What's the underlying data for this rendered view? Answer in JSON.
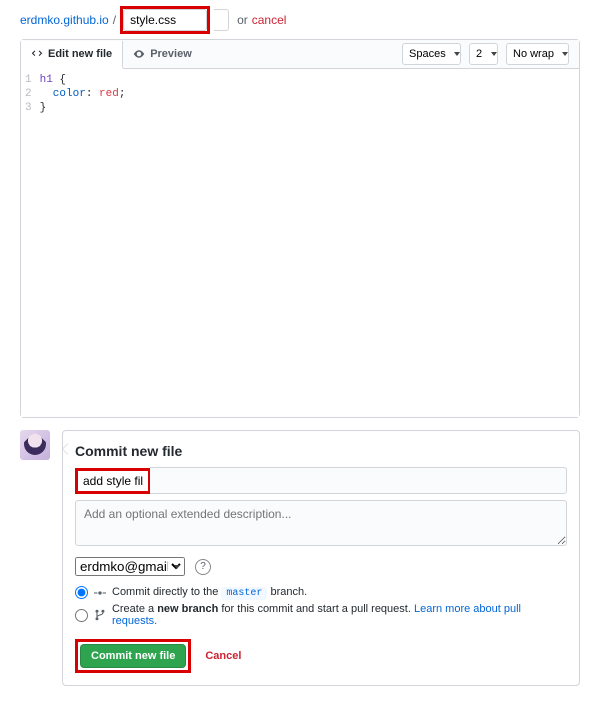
{
  "breadcrumb": {
    "repo": "erdmko.github.io",
    "filename": "style.css",
    "or": "or",
    "cancel": "cancel"
  },
  "tabs": {
    "edit": "Edit new file",
    "preview": "Preview"
  },
  "indent_mode": "Spaces",
  "indent_size": "2",
  "wrap_mode": "No wrap",
  "code": {
    "lines": [
      "1",
      "2",
      "3"
    ],
    "l1_sel": "h1",
    "l1_brace": " {",
    "l2_prop": "  color",
    "l2_colon": ": ",
    "l2_val": "red",
    "l2_semi": ";",
    "l3": "}"
  },
  "commit": {
    "heading": "Commit new file",
    "summary": "add style file",
    "desc_placeholder": "Add an optional extended description...",
    "author": "erdmko@gmail.com",
    "radio_direct_pre": "Commit directly to the ",
    "radio_direct_branch": "master",
    "radio_direct_post": " branch.",
    "radio_branch_pre": "Create a ",
    "radio_branch_bold": "new branch",
    "radio_branch_post": " for this commit and start a pull request. ",
    "radio_branch_link": "Learn more about pull requests.",
    "commit_btn": "Commit new file",
    "cancel_btn": "Cancel"
  }
}
